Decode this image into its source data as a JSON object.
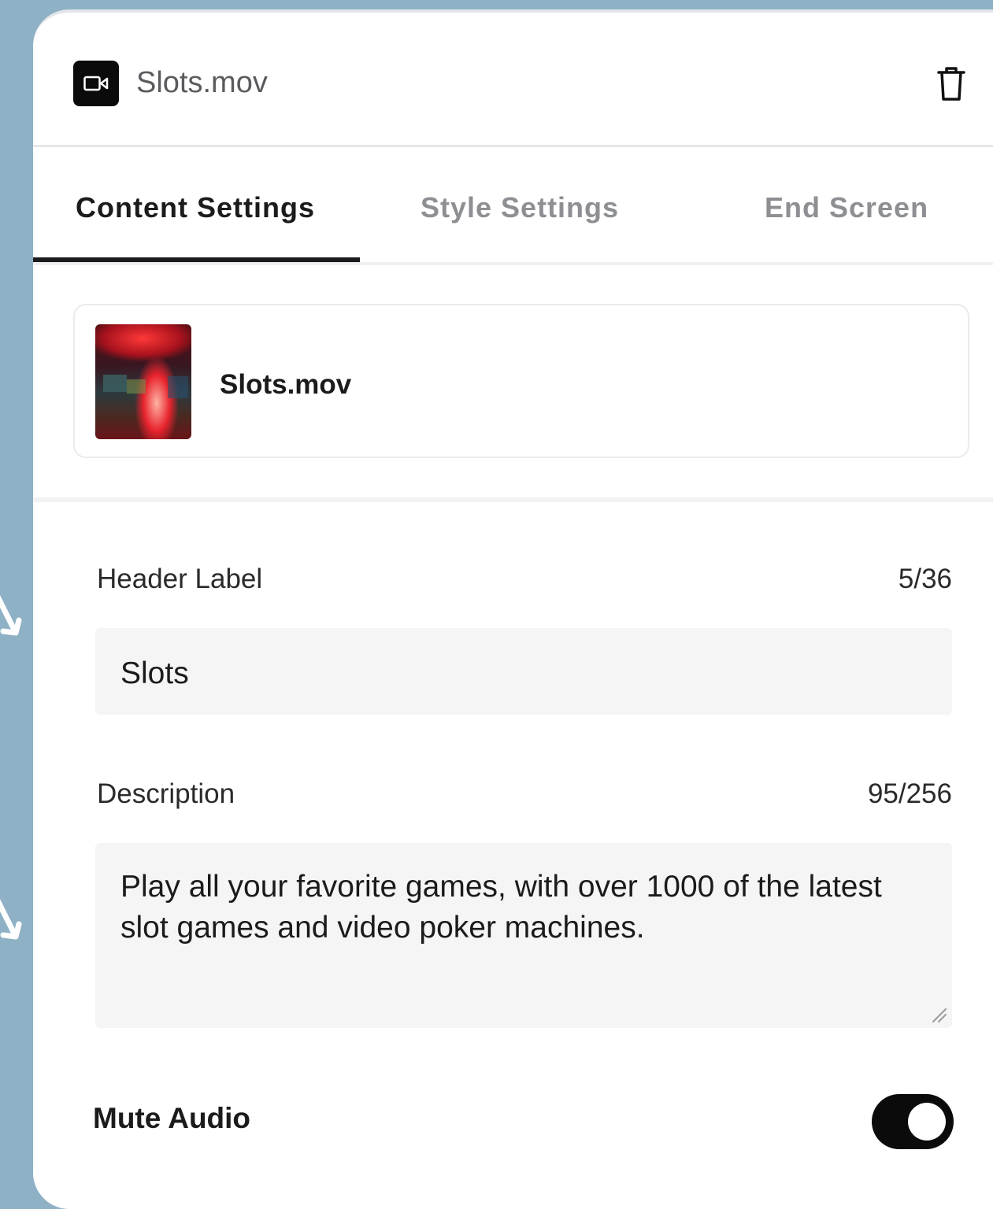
{
  "header": {
    "file_icon": "video-camera-icon",
    "title": "Slots.mov",
    "delete_icon": "trash-icon"
  },
  "tabs": [
    {
      "label": "Content Settings",
      "active": true
    },
    {
      "label": "Style Settings",
      "active": false
    },
    {
      "label": "End Screen",
      "active": false
    }
  ],
  "media": {
    "filename": "Slots.mov",
    "thumbnail": "slot-machine-thumbnail"
  },
  "fields": {
    "header_label": {
      "label": "Header Label",
      "counter": "5/36",
      "value": "Slots"
    },
    "description": {
      "label": "Description",
      "counter": "95/256",
      "value": "Play all your favorite games, with over 1000 of the latest slot games and video poker machines."
    }
  },
  "mute_audio": {
    "label": "Mute Audio",
    "enabled": true
  },
  "colors": {
    "background": "#8fb1c6",
    "accent": "#0b0b0b",
    "inactive_tab": "#8d8f93"
  }
}
